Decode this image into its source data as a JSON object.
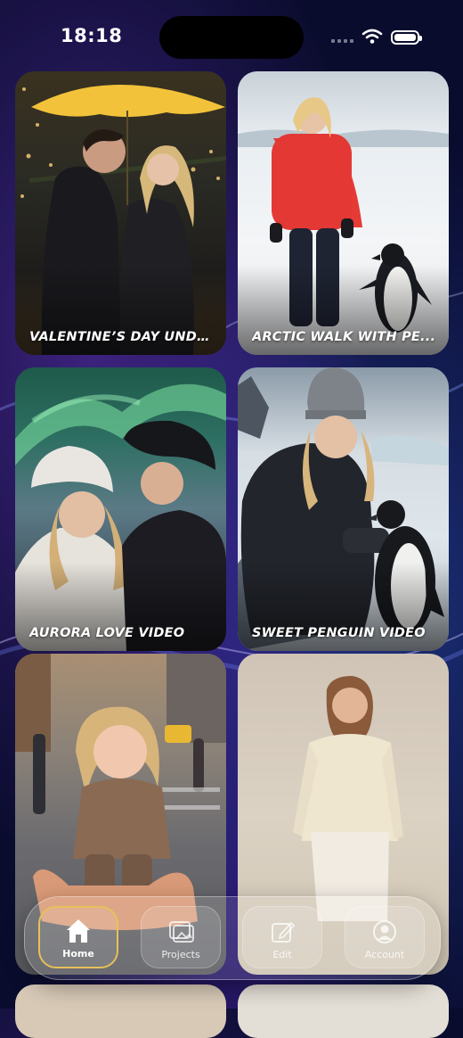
{
  "status_bar": {
    "time": "18:18"
  },
  "cards": [
    {
      "title": "VALENTINE’S DAY UNDE..."
    },
    {
      "title": "ARCTIC WALK WITH PE..."
    },
    {
      "title": "AURORA LOVE VIDEO"
    },
    {
      "title": "SWEET PENGUIN VIDEO"
    },
    {
      "title": ""
    },
    {
      "title": ""
    },
    {
      "title": ""
    },
    {
      "title": ""
    }
  ],
  "tab_bar": {
    "tabs": [
      {
        "label": "Home",
        "icon": "home-icon",
        "active": true
      },
      {
        "label": "Projects",
        "icon": "projects-icon",
        "active": false
      },
      {
        "label": "Edit",
        "icon": "edit-icon",
        "active": false
      },
      {
        "label": "Account",
        "icon": "account-icon",
        "active": false
      }
    ]
  },
  "colors": {
    "background": "#0a0c2e",
    "active_tab_border": "#e8c05a"
  }
}
